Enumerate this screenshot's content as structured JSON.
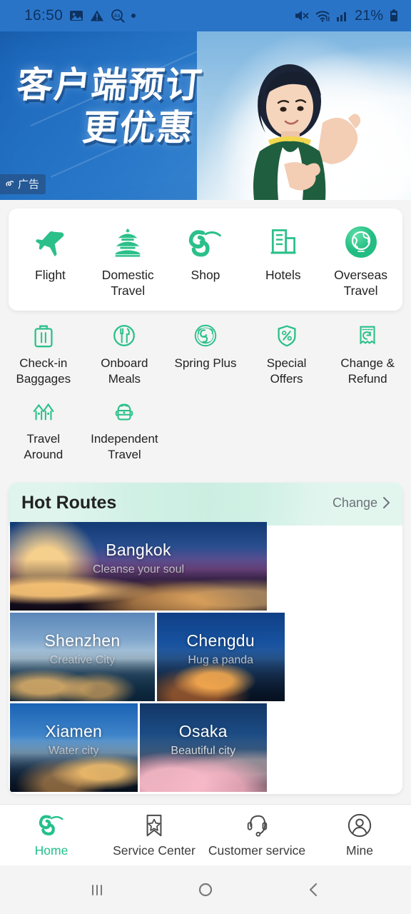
{
  "status_bar": {
    "time": "16:50",
    "battery": "21%",
    "icons_left": [
      "photo-icon",
      "warning-triangle-icon",
      "translate-icon",
      "dot-indicator"
    ],
    "icons_right": [
      "mute-icon",
      "wifi-icon",
      "signal-icon",
      "battery-icon"
    ],
    "background_color": "#2a74c8"
  },
  "banner": {
    "headline_line1": "客户端预订",
    "headline_line2": "更优惠",
    "ad_label": "广告",
    "ad_logo": "spring-airlines-logo"
  },
  "main_grid": {
    "items": [
      {
        "label": "Flight",
        "icon": "airplane-icon"
      },
      {
        "label": "Domestic Travel",
        "icon": "pagoda-icon"
      },
      {
        "label": "Shop",
        "icon": "spring-swirl-icon"
      },
      {
        "label": "Hotels",
        "icon": "buildings-icon"
      },
      {
        "label": "Overseas Travel",
        "icon": "globe-icon"
      }
    ]
  },
  "secondary_grid": {
    "row1": [
      {
        "label": "Check-in Baggages",
        "icon": "suitcase-icon"
      },
      {
        "label": "Onboard Meals",
        "icon": "cutlery-icon"
      },
      {
        "label": "Spring Plus",
        "icon": "spring-plus-emblem-icon"
      },
      {
        "label": "Special Offers",
        "icon": "percent-shield-icon"
      },
      {
        "label": "Change & Refund",
        "icon": "refund-receipt-icon"
      }
    ],
    "row2": [
      {
        "label": "Travel Around",
        "icon": "houses-icon"
      },
      {
        "label": "Independent Travel",
        "icon": "backpack-icon"
      }
    ]
  },
  "hot_routes": {
    "title": "Hot Routes",
    "change_label": "Change",
    "chevron": "chevron-right-icon",
    "routes": [
      {
        "city": "Bangkok",
        "tagline": "Cleanse your soul",
        "size": "wide"
      },
      {
        "city": "Shenzhen",
        "tagline": "Creative City",
        "size": "narrow"
      },
      {
        "city": "Chengdu",
        "tagline": "Hug a panda",
        "size": "third"
      },
      {
        "city": "Xiamen",
        "tagline": "Water city",
        "size": "third"
      },
      {
        "city": "Osaka",
        "tagline": "Beautiful city",
        "size": "third"
      }
    ]
  },
  "tab_bar": {
    "items": [
      {
        "label": "Home",
        "icon": "spring-swirl-icon",
        "active": true
      },
      {
        "label": "Service Center",
        "icon": "bookmark-star-icon",
        "active": false
      },
      {
        "label": "Customer service",
        "icon": "headset-icon",
        "active": false
      },
      {
        "label": "Mine",
        "icon": "user-circle-icon",
        "active": false
      }
    ],
    "active_color": "#22c08a"
  },
  "android_nav": {
    "recents": "recents-icon",
    "home": "home-circle-icon",
    "back": "back-chevron-icon"
  },
  "theme": {
    "accent_green": "#22c08a",
    "page_background": "#f4f4f4",
    "card_background": "#ffffff"
  }
}
